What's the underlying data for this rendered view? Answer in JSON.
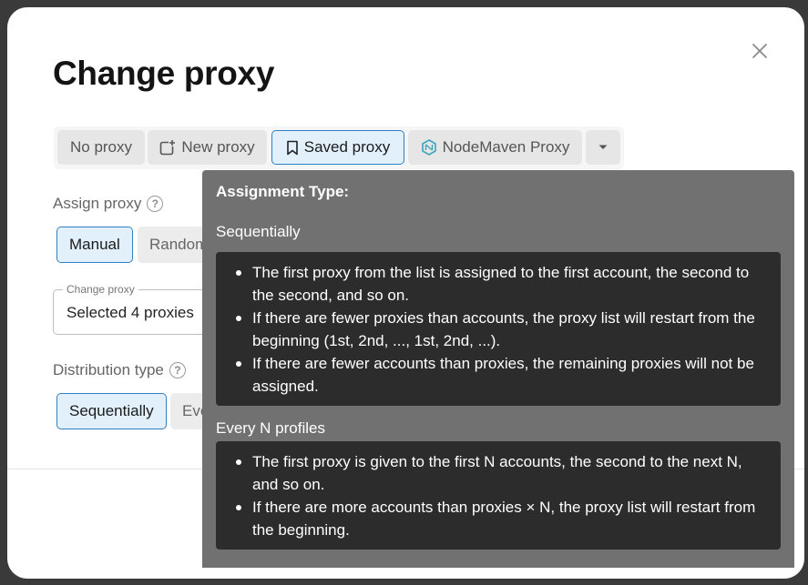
{
  "dialog": {
    "title": "Change proxy"
  },
  "tabs": [
    {
      "label": "No proxy",
      "icon": "none",
      "active": false
    },
    {
      "label": "New proxy",
      "icon": "add-window-icon",
      "active": false
    },
    {
      "label": "Saved proxy",
      "icon": "bookmark-icon",
      "active": true
    },
    {
      "label": "NodeMaven Proxy",
      "icon": "nodemaven-logo-icon",
      "active": false
    }
  ],
  "assign": {
    "label": "Assign proxy",
    "options": [
      "Manual",
      "Random"
    ],
    "selected": "Manual"
  },
  "proxy_select": {
    "legend": "Change proxy",
    "value": "Selected 4 proxies"
  },
  "distribution": {
    "label": "Distribution type",
    "options": [
      "Sequentially",
      "Every N profiles"
    ],
    "selected": "Sequentially"
  },
  "tooltip": {
    "heading": "Assignment Type:",
    "sections": [
      {
        "title": "Sequentially",
        "items": [
          "The first proxy from the list is assigned to the first account, the second to the second, and so on.",
          "If there are fewer proxies than accounts, the proxy list will restart from the beginning (1st, 2nd, ..., 1st, 2nd, ...).",
          "If there are fewer accounts than proxies, the remaining proxies will not be assigned."
        ]
      },
      {
        "title": "Every N profiles",
        "items": [
          "The first proxy is given to the first N accounts, the second to the next N, and so on.",
          "If there are more accounts than proxies × N, the proxy list will restart from the beginning."
        ]
      }
    ]
  },
  "colors": {
    "accent": "#2f7fc4",
    "active_bg": "#e2f0fb",
    "tooltip_bg": "#717171",
    "tooltip_box": "#2c2c2c",
    "nodemaven": "#3aa6b9"
  }
}
